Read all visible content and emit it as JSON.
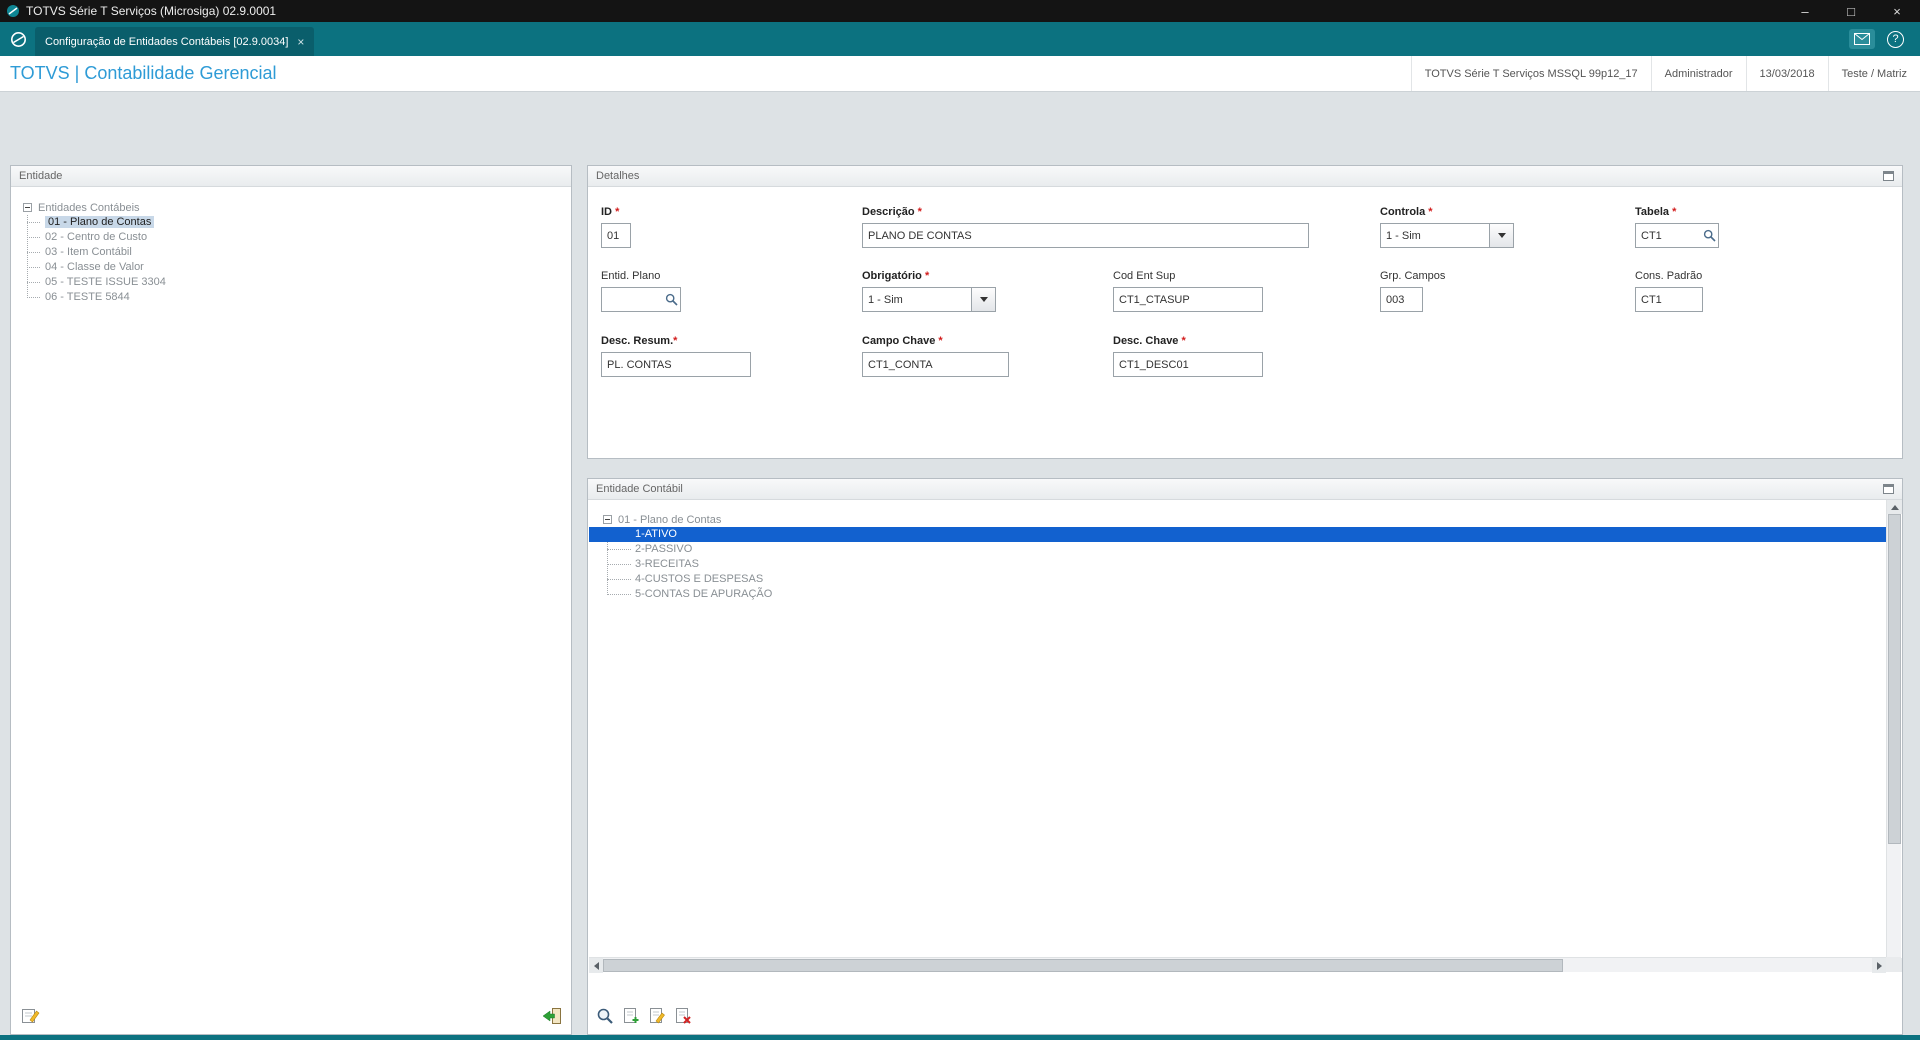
{
  "colors": {
    "teal": "#0c7280",
    "teal_dark": "#0a5e6b",
    "titlebar": "#141414",
    "brand_blue": "#2e9bd6",
    "selection_blue": "#1261cf",
    "tree_selection_bg": "#c8d8e8",
    "main_bg": "#dde2e5",
    "required_red": "#d21c1c"
  },
  "window": {
    "title": "TOTVS Série T Serviços (Microsiga) 02.9.0001",
    "minimize": "–",
    "maximize": "□",
    "close": "×"
  },
  "tabbar": {
    "active_tab": "Configuração de Entidades Contábeis [02.9.0034]",
    "tab_close": "×",
    "help": "?"
  },
  "header": {
    "title": "TOTVS | Contabilidade Gerencial",
    "environment": "TOTVS Série T Serviços MSSQL 99p12_17",
    "user": "Administrador",
    "date": "13/03/2018",
    "company": "Teste / Matriz"
  },
  "required_marker": "*",
  "entity_panel": {
    "title": "Entidade",
    "root": "Entidades Contábeis",
    "items": [
      {
        "label": "01 - Plano de Contas"
      },
      {
        "label": "02 - Centro de Custo"
      },
      {
        "label": "03 - Item Contábil"
      },
      {
        "label": "04 - Classe de Valor"
      },
      {
        "label": "05 - TESTE ISSUE 3304"
      },
      {
        "label": "06 - TESTE 5844"
      }
    ]
  },
  "details_panel": {
    "title": "Detalhes",
    "fields": {
      "id": {
        "label": "ID",
        "value": "01"
      },
      "descricao": {
        "label": "Descrição",
        "value": "PLANO DE CONTAS"
      },
      "controla": {
        "label": "Controla",
        "value": "1 - Sim"
      },
      "tabela": {
        "label": "Tabela",
        "value": "CT1"
      },
      "entid_plano": {
        "label": "Entid. Plano",
        "value": ""
      },
      "obrigatorio": {
        "label": "Obrigatório",
        "value": "1 - Sim"
      },
      "cod_ent_sup": {
        "label": "Cod Ent Sup",
        "value": "CT1_CTASUP"
      },
      "grp_campos": {
        "label": "Grp. Campos",
        "value": "003"
      },
      "cons_padrao": {
        "label": "Cons. Padrão",
        "value": "CT1"
      },
      "desc_resum": {
        "label": "Desc. Resum.",
        "value": "PL. CONTAS"
      },
      "campo_chave": {
        "label": "Campo Chave",
        "value": "CT1_CONTA"
      },
      "desc_chave": {
        "label": "Desc. Chave",
        "value": "CT1_DESC01"
      }
    }
  },
  "contabil_panel": {
    "title": "Entidade Contábil",
    "root": "01 - Plano de Contas",
    "items": [
      {
        "label": "1-ATIVO"
      },
      {
        "label": "2-PASSIVO"
      },
      {
        "label": "3-RECEITAS"
      },
      {
        "label": "4-CUSTOS E DESPESAS"
      },
      {
        "label": "5-CONTAS DE APURAÇÃO"
      }
    ]
  }
}
